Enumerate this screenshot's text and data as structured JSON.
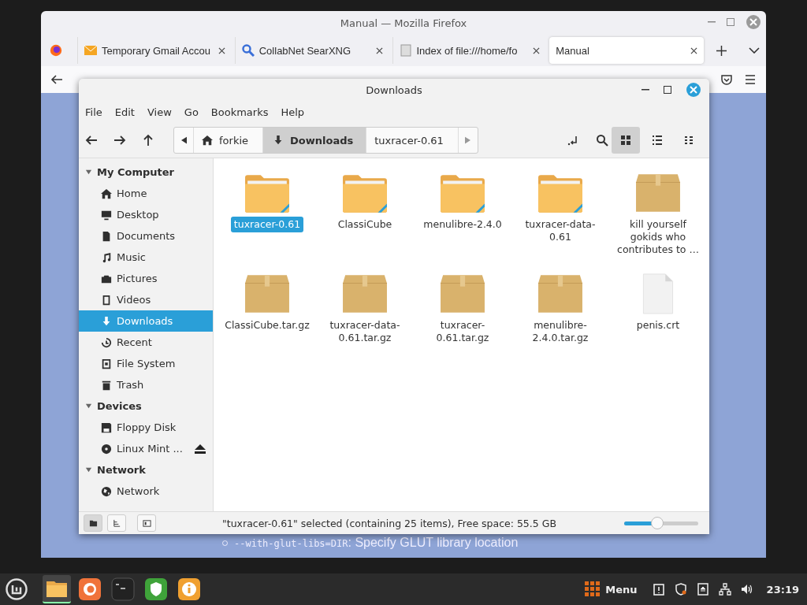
{
  "browser": {
    "title": "Manual — Mozilla Firefox",
    "tabs": [
      {
        "label": "Temporary Gmail Accou",
        "kind": "mail",
        "selected": false
      },
      {
        "label": "CollabNet SearXNG",
        "kind": "search",
        "selected": false
      },
      {
        "label": "Index of file:///home/fo",
        "kind": "page",
        "selected": false
      },
      {
        "label": "Manual",
        "kind": "plain",
        "selected": true
      }
    ],
    "page_line": {
      "code": "--with-glut-libs=DIR",
      "text": ": Specify GLUT library location"
    }
  },
  "file_manager": {
    "title": "Downloads",
    "menu": [
      "File",
      "Edit",
      "View",
      "Go",
      "Bookmarks",
      "Help"
    ],
    "breadcrumbs": [
      {
        "label": "forkie",
        "kind": "home",
        "selected": false
      },
      {
        "label": "Downloads",
        "kind": "download",
        "selected": true
      },
      {
        "label": "tuxracer-0.61",
        "kind": "plain",
        "selected": false
      }
    ],
    "view_modes": [
      {
        "kind": "icons",
        "selected": true
      },
      {
        "kind": "list",
        "selected": false
      },
      {
        "kind": "compact",
        "selected": false
      }
    ],
    "sidebar": [
      {
        "heading": "My Computer",
        "expanded": true,
        "items": [
          {
            "label": "Home",
            "kind": "home",
            "selected": false,
            "ejectable": false
          },
          {
            "label": "Desktop",
            "kind": "desktop",
            "selected": false,
            "ejectable": false
          },
          {
            "label": "Documents",
            "kind": "document",
            "selected": false,
            "ejectable": false
          },
          {
            "label": "Music",
            "kind": "music",
            "selected": false,
            "ejectable": false
          },
          {
            "label": "Pictures",
            "kind": "camera",
            "selected": false,
            "ejectable": false
          },
          {
            "label": "Videos",
            "kind": "film",
            "selected": false,
            "ejectable": false
          },
          {
            "label": "Downloads",
            "kind": "download",
            "selected": true,
            "ejectable": false
          },
          {
            "label": "Recent",
            "kind": "history",
            "selected": false,
            "ejectable": false
          },
          {
            "label": "File System",
            "kind": "drive",
            "selected": false,
            "ejectable": false
          },
          {
            "label": "Trash",
            "kind": "trash",
            "selected": false,
            "ejectable": false
          }
        ]
      },
      {
        "heading": "Devices",
        "expanded": true,
        "items": [
          {
            "label": "Floppy Disk",
            "kind": "floppy",
            "selected": false,
            "ejectable": false
          },
          {
            "label": "Linux Mint ...",
            "kind": "disc",
            "selected": false,
            "ejectable": true
          }
        ]
      },
      {
        "heading": "Network",
        "expanded": true,
        "items": [
          {
            "label": "Network",
            "kind": "globe",
            "selected": false,
            "ejectable": false
          }
        ]
      }
    ],
    "files": [
      {
        "name": "tuxracer-0.61",
        "kind": "folder",
        "selected": true
      },
      {
        "name": "ClassiCube",
        "kind": "folder",
        "selected": false
      },
      {
        "name": "menulibre-2.4.0",
        "kind": "folder",
        "selected": false
      },
      {
        "name": "tuxracer-data-0.61",
        "kind": "folder",
        "selected": false
      },
      {
        "name": "kill yourself gokids who contributes to …",
        "kind": "archive",
        "selected": false
      },
      {
        "name": "ClassiCube.tar.gz",
        "kind": "archive",
        "selected": false
      },
      {
        "name": "tuxracer-data-0.61.tar.gz",
        "kind": "archive",
        "selected": false
      },
      {
        "name": "tuxracer-0.61.tar.gz",
        "kind": "archive",
        "selected": false
      },
      {
        "name": "menulibre-2.4.0.tar.gz",
        "kind": "archive",
        "selected": false
      },
      {
        "name": "penis.crt",
        "kind": "file",
        "selected": false
      }
    ],
    "status": "\"tuxracer-0.61\" selected (containing 25 items), Free space: 55.5 GB",
    "zoom": {
      "level": 0.45
    }
  },
  "taskbar": {
    "launchers": [
      {
        "kind": "folder",
        "selected": true
      },
      {
        "kind": "firefox",
        "selected": false
      },
      {
        "kind": "terminal",
        "selected": false
      },
      {
        "kind": "shield",
        "selected": false
      },
      {
        "kind": "info",
        "selected": false
      }
    ],
    "menu_label": "Menu",
    "clock": "23:19"
  }
}
